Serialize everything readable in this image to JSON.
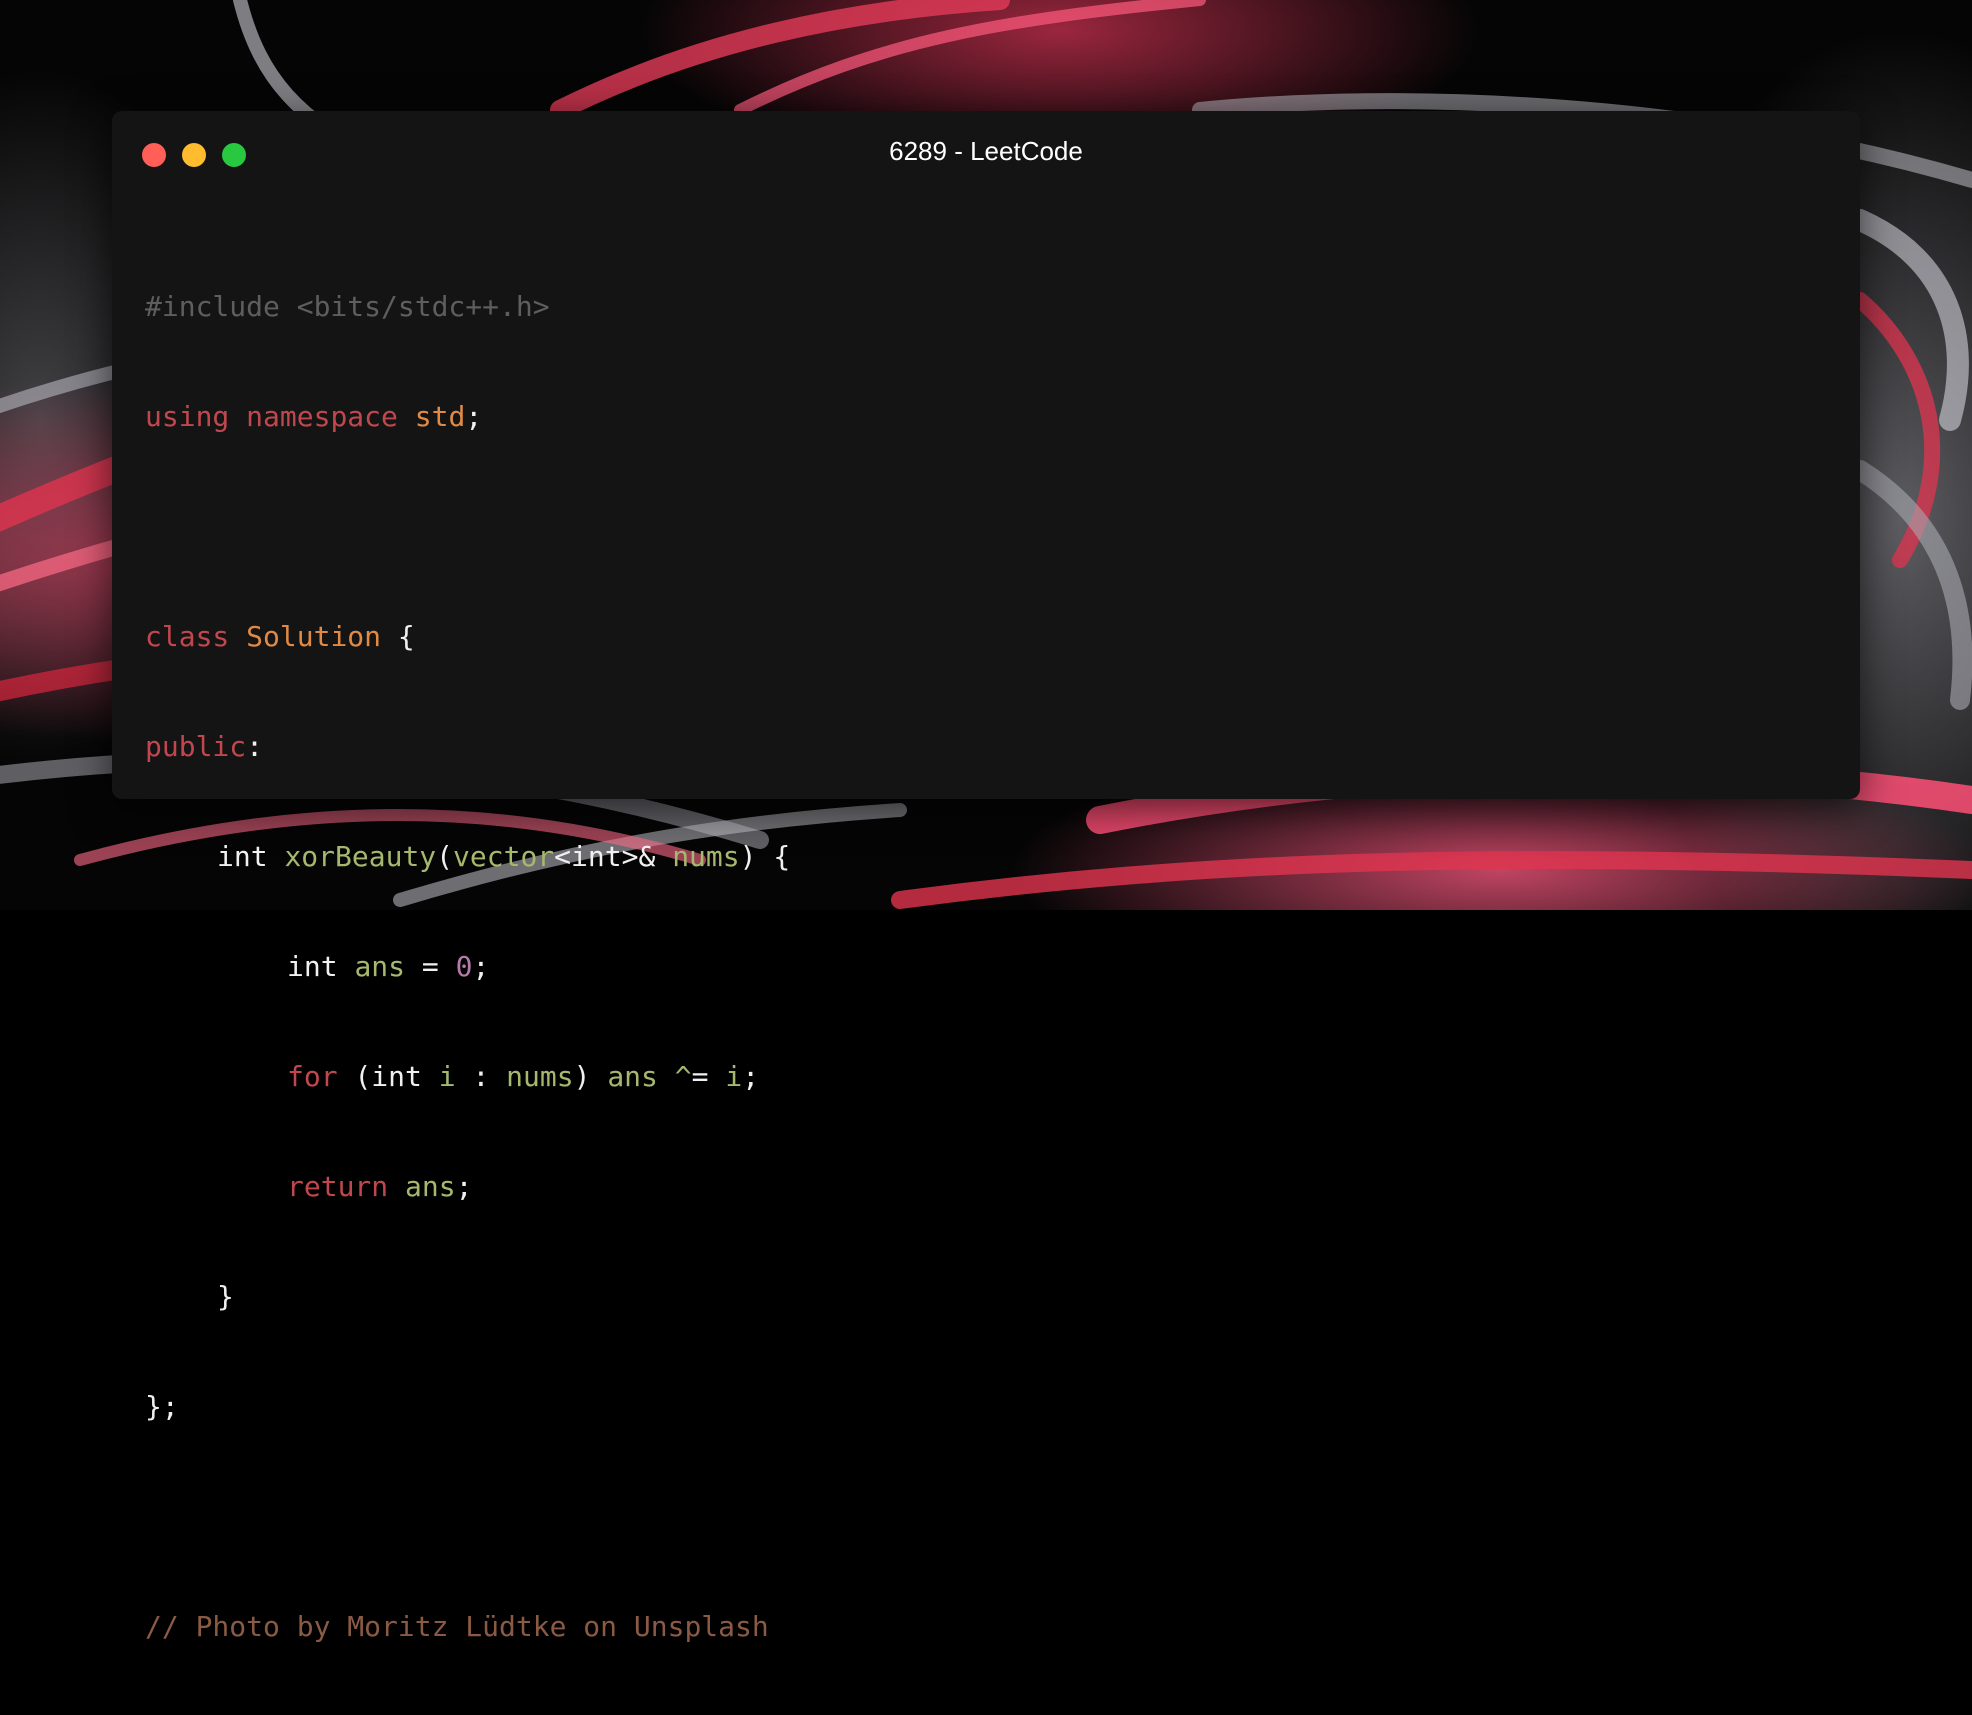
{
  "window": {
    "title": "6289 - LeetCode"
  },
  "code": {
    "line1": {
      "directive": "#include <bits/stdc++.h>"
    },
    "line2": {
      "kw1": "using",
      "kw2": "namespace",
      "ns": "std",
      "end": ";"
    },
    "line4": {
      "kw": "class",
      "name": "Solution",
      "brace": "{"
    },
    "line5": {
      "kw": "public",
      "colon": ":"
    },
    "line6": {
      "ret": "int",
      "fn": "xorBeauty",
      "lp": "(",
      "type": "vector",
      "tmpl": "<int>&",
      "param": "nums",
      "rp": ") {"
    },
    "line7": {
      "type": "int",
      "var": "ans",
      "eq": "=",
      "num": "0",
      "end": ";"
    },
    "line8": {
      "kw": "for",
      "lp": "(int",
      "var": "i",
      "colon": ":",
      "range": "nums",
      "rp": ")",
      "acc": "ans",
      "op": "^",
      "eq": "=",
      "var2": "i",
      "end": ";"
    },
    "line9": {
      "kw": "return",
      "var": "ans",
      "end": ";"
    },
    "line10": {
      "brace": "}"
    },
    "line11": {
      "end": "};"
    },
    "line13": {
      "comment": "// Photo by Moritz Lüdtke on Unsplash"
    }
  },
  "colors": {
    "window_bg": "#141414",
    "keyword": "#c0474d",
    "type": "#e08a45",
    "identifier": "#a5b86d",
    "number": "#b67ba8",
    "comment": "#8a5a44",
    "preprocessor": "#5e5e5e"
  }
}
